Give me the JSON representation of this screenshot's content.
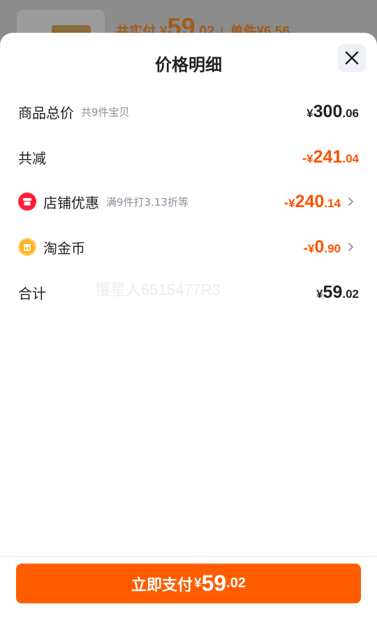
{
  "background": {
    "total_label": "共实付",
    "currency": "¥",
    "total_int": "59",
    "total_dec": ".02",
    "unit_label": "单件",
    "unit_price": "¥6.56"
  },
  "sheet": {
    "title": "价格明细",
    "close_icon": "close-icon"
  },
  "rows": {
    "goods_total": {
      "label": "商品总价",
      "sub": "共9件宝贝",
      "currency": "¥",
      "int": "300",
      "dec": ".06"
    },
    "total_reduction": {
      "label": "共减",
      "prefix": "-",
      "currency": "¥",
      "int": "241",
      "dec": ".04"
    },
    "shop_discount": {
      "label": "店铺优惠",
      "sub": "满9件打3.13折等",
      "prefix": "-",
      "currency": "¥",
      "int": "240",
      "dec": ".14",
      "icon": "shop-icon"
    },
    "taojinbi": {
      "label": "淘金币",
      "prefix": "-",
      "currency": "¥",
      "int": "0",
      "dec": ".90",
      "icon": "coin-icon"
    },
    "sum": {
      "label": "合计",
      "currency": "¥",
      "int": "59",
      "dec": ".02"
    }
  },
  "watermark": "慢星人6515477R3",
  "pay_button": {
    "label": "立即支付",
    "currency": "¥",
    "int": "59",
    "dec": ".02"
  },
  "colors": {
    "accent": "#ff5000",
    "button": "#ff5c00",
    "shop_icon": "#ff1e3a",
    "coin_icon": "#ffb32a"
  }
}
